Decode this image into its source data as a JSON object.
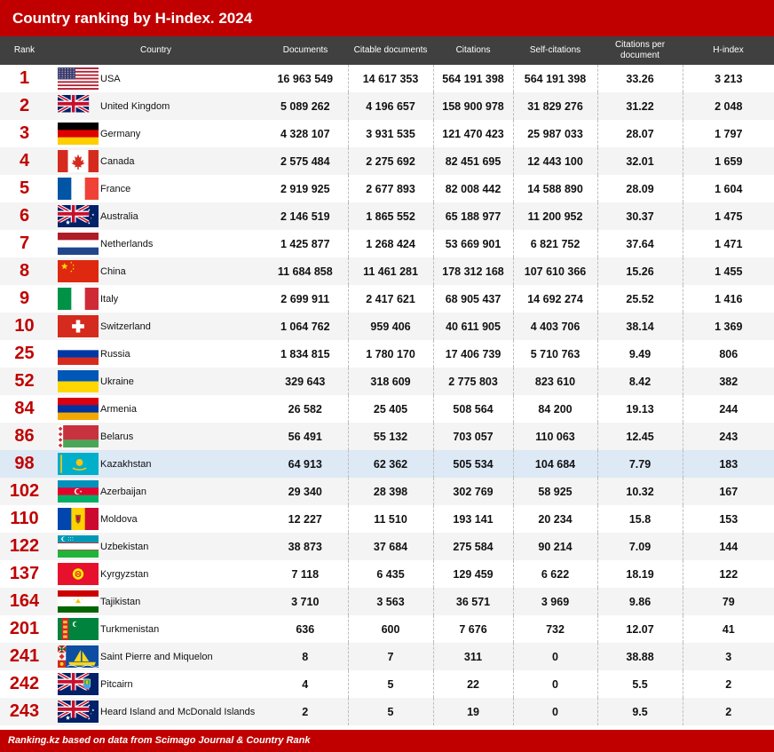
{
  "title": "Country ranking by H-index. 2024",
  "footer": "Ranking.kz based on data from Scimago Journal & Country Rank",
  "colors": {
    "brand": "#c00000",
    "header_bg": "#404040",
    "highlight_row": "#dde9f5",
    "zebra": "#f4f4f4"
  },
  "chart_data": {
    "type": "table",
    "title": "Country ranking by H-index. 2024",
    "columns": [
      "Rank",
      "Country",
      "Documents",
      "Citable documents",
      "Citations",
      "Self-citations",
      "Citations per document",
      "H-index"
    ],
    "highlighted_country": "Kazakhstan",
    "rows": [
      {
        "rank": "1",
        "country": "USA",
        "flag": "us-flag-icon",
        "documents": "16 963 549",
        "citable": "14 617 353",
        "citations": "564 191 398",
        "self": "564 191 398",
        "cpd": "33.26",
        "h": "3 213"
      },
      {
        "rank": "2",
        "country": "United Kingdom",
        "flag": "uk-flag-icon",
        "documents": "5 089 262",
        "citable": "4 196 657",
        "citations": "158 900 978",
        "self": "31 829 276",
        "cpd": "31.22",
        "h": "2 048"
      },
      {
        "rank": "3",
        "country": "Germany",
        "flag": "germany-flag-icon",
        "documents": "4 328 107",
        "citable": "3 931 535",
        "citations": "121 470 423",
        "self": "25 987 033",
        "cpd": "28.07",
        "h": "1 797"
      },
      {
        "rank": "4",
        "country": "Canada",
        "flag": "canada-flag-icon",
        "documents": "2 575 484",
        "citable": "2 275 692",
        "citations": "82 451 695",
        "self": "12 443 100",
        "cpd": "32.01",
        "h": "1 659"
      },
      {
        "rank": "5",
        "country": "France",
        "flag": "france-flag-icon",
        "documents": "2 919 925",
        "citable": "2 677 893",
        "citations": "82 008 442",
        "self": "14 588 890",
        "cpd": "28.09",
        "h": "1 604"
      },
      {
        "rank": "6",
        "country": "Australia",
        "flag": "australia-flag-icon",
        "documents": "2 146 519",
        "citable": "1 865 552",
        "citations": "65 188 977",
        "self": "11 200 952",
        "cpd": "30.37",
        "h": "1 475"
      },
      {
        "rank": "7",
        "country": "Netherlands",
        "flag": "netherlands-flag-icon",
        "documents": "1 425 877",
        "citable": "1 268 424",
        "citations": "53 669 901",
        "self": "6 821 752",
        "cpd": "37.64",
        "h": "1 471"
      },
      {
        "rank": "8",
        "country": "China",
        "flag": "china-flag-icon",
        "documents": "11 684 858",
        "citable": "11 461 281",
        "citations": "178 312 168",
        "self": "107 610 366",
        "cpd": "15.26",
        "h": "1 455"
      },
      {
        "rank": "9",
        "country": "Italy",
        "flag": "italy-flag-icon",
        "documents": "2 699 911",
        "citable": "2 417 621",
        "citations": "68 905 437",
        "self": "14 692 274",
        "cpd": "25.52",
        "h": "1 416"
      },
      {
        "rank": "10",
        "country": "Switzerland",
        "flag": "switzerland-flag-icon",
        "documents": "1 064 762",
        "citable": "959 406",
        "citations": "40 611 905",
        "self": "4 403 706",
        "cpd": "38.14",
        "h": "1 369"
      },
      {
        "rank": "25",
        "country": "Russia",
        "flag": "russia-flag-icon",
        "documents": "1 834 815",
        "citable": "1 780 170",
        "citations": "17 406 739",
        "self": "5 710 763",
        "cpd": "9.49",
        "h": "806"
      },
      {
        "rank": "52",
        "country": "Ukraine",
        "flag": "ukraine-flag-icon",
        "documents": "329 643",
        "citable": "318 609",
        "citations": "2 775 803",
        "self": "823 610",
        "cpd": "8.42",
        "h": "382"
      },
      {
        "rank": "84",
        "country": "Armenia",
        "flag": "armenia-flag-icon",
        "documents": "26 582",
        "citable": "25 405",
        "citations": "508 564",
        "self": "84 200",
        "cpd": "19.13",
        "h": "244"
      },
      {
        "rank": "86",
        "country": "Belarus",
        "flag": "belarus-flag-icon",
        "documents": "56 491",
        "citable": "55 132",
        "citations": "703 057",
        "self": "110 063",
        "cpd": "12.45",
        "h": "243"
      },
      {
        "rank": "98",
        "country": "Kazakhstan",
        "flag": "kazakhstan-flag-icon",
        "documents": "64 913",
        "citable": "62 362",
        "citations": "505 534",
        "self": "104 684",
        "cpd": "7.79",
        "h": "183"
      },
      {
        "rank": "102",
        "country": "Azerbaijan",
        "flag": "azerbaijan-flag-icon",
        "documents": "29 340",
        "citable": "28 398",
        "citations": "302 769",
        "self": "58 925",
        "cpd": "10.32",
        "h": "167"
      },
      {
        "rank": "110",
        "country": "Moldova",
        "flag": "moldova-flag-icon",
        "documents": "12 227",
        "citable": "11 510",
        "citations": "193 141",
        "self": "20 234",
        "cpd": "15.8",
        "h": "153"
      },
      {
        "rank": "122",
        "country": "Uzbekistan",
        "flag": "uzbekistan-flag-icon",
        "documents": "38 873",
        "citable": "37 684",
        "citations": "275 584",
        "self": "90 214",
        "cpd": "7.09",
        "h": "144"
      },
      {
        "rank": "137",
        "country": "Kyrgyzstan",
        "flag": "kyrgyzstan-flag-icon",
        "documents": "7 118",
        "citable": "6 435",
        "citations": "129 459",
        "self": "6 622",
        "cpd": "18.19",
        "h": "122"
      },
      {
        "rank": "164",
        "country": "Tajikistan",
        "flag": "tajikistan-flag-icon",
        "documents": "3 710",
        "citable": "3 563",
        "citations": "36 571",
        "self": "3 969",
        "cpd": "9.86",
        "h": "79"
      },
      {
        "rank": "201",
        "country": "Turkmenistan",
        "flag": "turkmenistan-flag-icon",
        "documents": "636",
        "citable": "600",
        "citations": "7 676",
        "self": "732",
        "cpd": "12.07",
        "h": "41"
      },
      {
        "rank": "241",
        "country": "Saint Pierre and Miquelon",
        "flag": "saint-pierre-miquelon-flag-icon",
        "documents": "8",
        "citable": "7",
        "citations": "311",
        "self": "0",
        "cpd": "38.88",
        "h": "3"
      },
      {
        "rank": "242",
        "country": "Pitcairn",
        "flag": "pitcairn-flag-icon",
        "documents": "4",
        "citable": "5",
        "citations": "22",
        "self": "0",
        "cpd": "5.5",
        "h": "2"
      },
      {
        "rank": "243",
        "country": "Heard Island and McDonald Islands",
        "flag": "heard-mcdonald-flag-icon",
        "documents": "2",
        "citable": "5",
        "citations": "19",
        "self": "0",
        "cpd": "9.5",
        "h": "2"
      }
    ]
  }
}
